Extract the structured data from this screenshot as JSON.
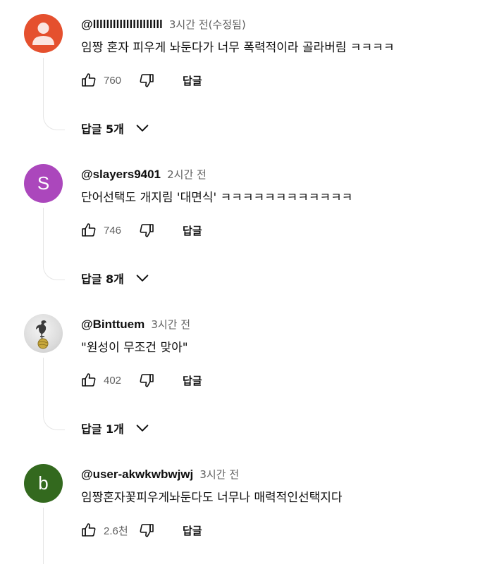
{
  "comments": [
    {
      "author": "@lllllllllllllllllllll",
      "time": "3시간 전(수정됨)",
      "text": "임짱 혼자 피우게 놔둔다가 너무 폭력적이라 골라버림 ㅋㅋㅋㅋ",
      "likes": "760",
      "reply_label": "답글",
      "replies_label": "답글 5개",
      "avatar": {
        "type": "default-person",
        "icon": "person-icon",
        "color": "#e5502e"
      }
    },
    {
      "author": "@slayers9401",
      "time": "2시간 전",
      "text": "단어선택도 개지림 '대면식' ㅋㅋㅋㅋㅋㅋㅋㅋㅋㅋㅋㅋ",
      "likes": "746",
      "reply_label": "답글",
      "replies_label": "답글 8개",
      "avatar": {
        "type": "letter",
        "letter": "S",
        "color": "#ab47bc"
      }
    },
    {
      "author": "@Binttuem",
      "time": "3시간 전",
      "text": "\"원성이 무조건 맞아\"",
      "likes": "402",
      "reply_label": "답글",
      "replies_label": "답글 1개",
      "avatar": {
        "type": "logo",
        "icon": "cockerel-logo-icon",
        "color": "#d8d8d8"
      }
    },
    {
      "author": "@user-akwkwbwjwj",
      "time": "3시간 전",
      "text": "임짱혼자꽃피우게놔둔다도 너무나 매력적인선택지다",
      "likes": "2.6천",
      "reply_label": "답글",
      "avatar": {
        "type": "letter",
        "letter": "b",
        "color": "#33691e"
      }
    }
  ]
}
